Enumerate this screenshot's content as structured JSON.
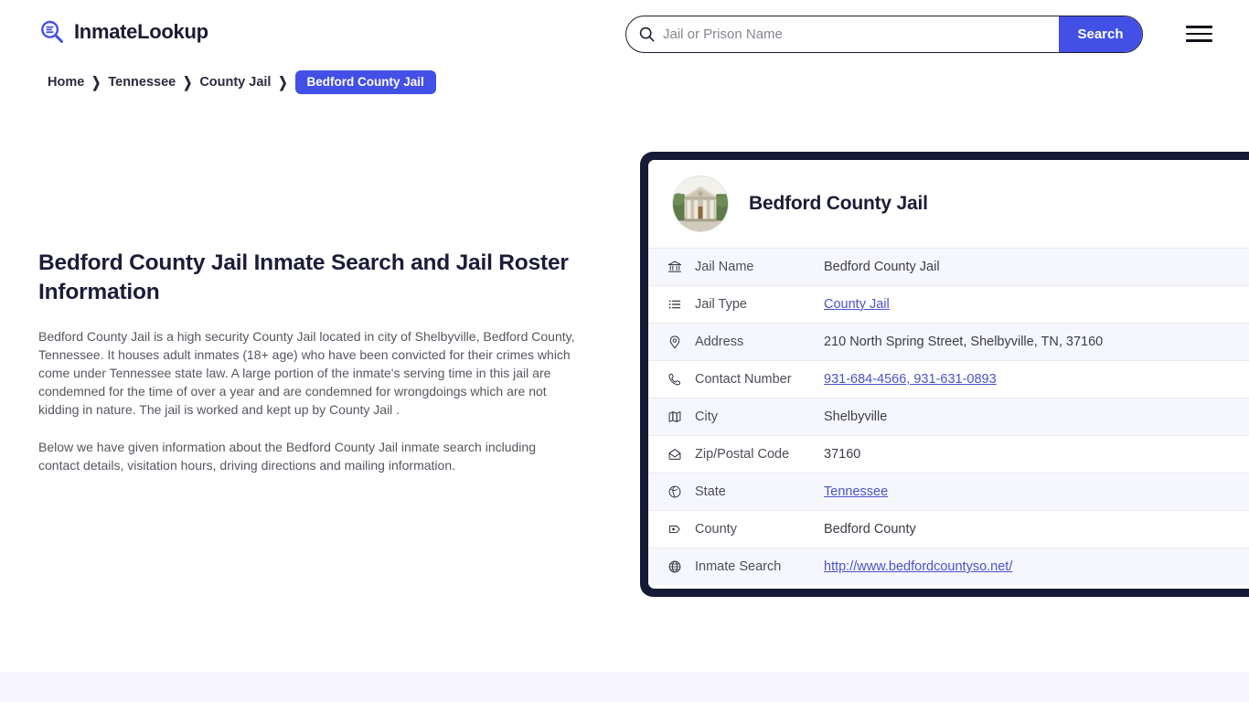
{
  "header": {
    "logo_text": "InmateLookup",
    "logo_icon": "magnifier-list-icon",
    "search": {
      "placeholder": "Jail or Prison Name",
      "value": "",
      "button_label": "Search",
      "icon": "search-icon"
    },
    "menu_icon": "hamburger-menu-icon"
  },
  "breadcrumb": {
    "items": [
      {
        "label": "Home",
        "current": false
      },
      {
        "label": "Tennessee",
        "current": false
      },
      {
        "label": "County Jail",
        "current": false
      },
      {
        "label": "Bedford County Jail",
        "current": true
      }
    ],
    "separator": "❯"
  },
  "main": {
    "title": "Bedford County Jail Inmate Search and Jail Roster Information",
    "paragraphs": [
      "Bedford County Jail is a high security County Jail located in city of Shelbyville, Bedford County, Tennessee. It houses adult inmates (18+ age) who have been convicted for their crimes which come under Tennessee state law. A large portion of the inmate's serving time in this jail are condemned for the time of over a year and are condemned for wrongdoings which are not kidding in nature. The jail is worked and kept up by County Jail .",
      "Below we have given information about the Bedford County Jail inmate search including contact details, visitation hours, driving directions and mailing information."
    ]
  },
  "card": {
    "title": "Bedford County Jail",
    "avatar_icon": "courthouse-photo",
    "rows": [
      {
        "icon": "bank-icon",
        "label": "Jail Name",
        "value": "Bedford County Jail",
        "is_link": false
      },
      {
        "icon": "list-icon",
        "label": "Jail Type",
        "value": "County Jail",
        "is_link": true
      },
      {
        "icon": "map-pin-icon",
        "label": "Address",
        "value": "210 North Spring Street, Shelbyville, TN, 37160",
        "is_link": false
      },
      {
        "icon": "phone-icon",
        "label": "Contact Number",
        "value": "931-684-4566, 931-631-0893",
        "is_link": true
      },
      {
        "icon": "map-icon",
        "label": "City",
        "value": "Shelbyville",
        "is_link": false
      },
      {
        "icon": "envelope-icon",
        "label": "Zip/Postal Code",
        "value": "37160",
        "is_link": false
      },
      {
        "icon": "globe-icon",
        "label": "State",
        "value": "Tennessee",
        "is_link": true
      },
      {
        "icon": "county-pin-icon",
        "label": "County",
        "value": "Bedford County",
        "is_link": false
      },
      {
        "icon": "web-globe-icon",
        "label": "Inmate Search",
        "value": "http://www.bedfordcountyso.net/",
        "is_link": true
      }
    ]
  },
  "colors": {
    "accent_blue": "#4350e6",
    "card_border": "#161a35",
    "title_navy": "#1b1c38",
    "link": "#4a52c8",
    "row_alt_bg": "#f6f7fc",
    "footer_band": "#f6f5ff"
  }
}
